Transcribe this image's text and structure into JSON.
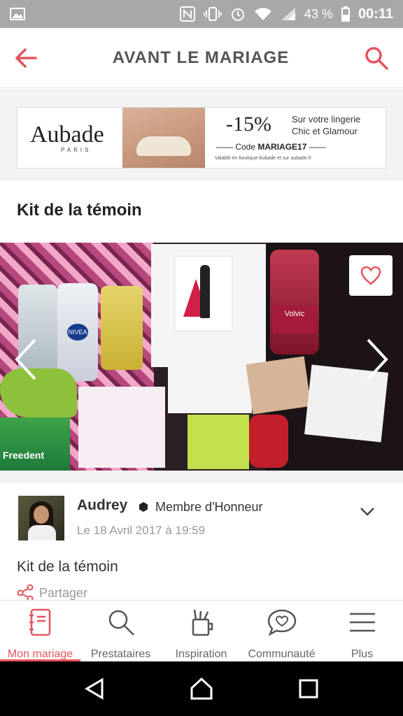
{
  "status_bar": {
    "battery": "43 %",
    "time": "00:11"
  },
  "header": {
    "title": "AVANT LE MARIAGE"
  },
  "ad": {
    "brand": "Aubade",
    "brand_sub": "PARIS",
    "discount": "-15%",
    "line1": "Sur votre lingerie",
    "line2": "Chic et Glamour",
    "code_prefix": "Code",
    "code": "MARIAGE17",
    "fine_print": "Valable en boutique Aubade et sur aubade.fr"
  },
  "post": {
    "title": "Kit de la témoin",
    "photo_texts": {
      "bottle_label": "Volvic",
      "gum": "Freedent",
      "nivea": "NIVEA"
    },
    "author": {
      "name": "Audrey",
      "rank": "Membre d'Honneur",
      "date": "Le 18 Avril 2017 à 19:59"
    },
    "body": "Kit de la témoin",
    "share_label": "Partager"
  },
  "tabs": [
    {
      "label": "Mon mariage",
      "icon": "notebook-icon",
      "active": true
    },
    {
      "label": "Prestataires",
      "icon": "search-icon",
      "active": false
    },
    {
      "label": "Inspiration",
      "icon": "brushes-icon",
      "active": false
    },
    {
      "label": "Communauté",
      "icon": "chat-heart-icon",
      "active": false
    },
    {
      "label": "Plus",
      "icon": "menu-icon",
      "active": false
    }
  ],
  "colors": {
    "accent": "#e2545e",
    "status_bar": "#a8a8a8"
  }
}
